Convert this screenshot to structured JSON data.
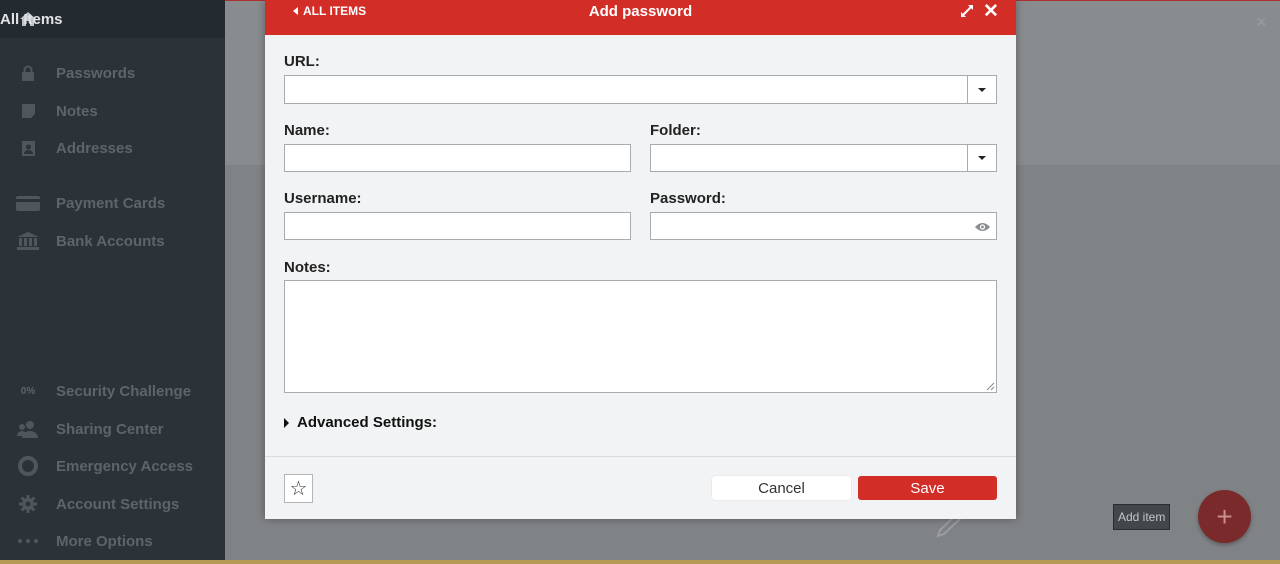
{
  "sidebar": {
    "top": {
      "label": "All Items",
      "icon": "home-icon"
    },
    "items": [
      {
        "label": "Passwords",
        "icon": "lock-icon"
      },
      {
        "label": "Notes",
        "icon": "note-icon"
      },
      {
        "label": "Addresses",
        "icon": "address-card-icon"
      },
      {
        "label": "Payment Cards",
        "icon": "credit-card-icon"
      },
      {
        "label": "Bank Accounts",
        "icon": "bank-icon"
      },
      {
        "label": "Security Challenge",
        "icon": "security-percent-icon",
        "badge": "0%"
      },
      {
        "label": "Sharing Center",
        "icon": "sharing-icon"
      },
      {
        "label": "Emergency Access",
        "icon": "lifebuoy-icon"
      },
      {
        "label": "Account Settings",
        "icon": "gear-icon"
      },
      {
        "label": "More Options",
        "icon": "dots-icon"
      }
    ]
  },
  "background": {
    "close_glyph": "×",
    "tooltip": "Add item",
    "fab_glyph": "+"
  },
  "modal": {
    "back_label": "ALL ITEMS",
    "title": "Add password",
    "close_glyph": "✕",
    "fields": {
      "url_label": "URL:",
      "url_value": "",
      "name_label": "Name:",
      "name_value": "",
      "folder_label": "Folder:",
      "folder_value": "",
      "username_label": "Username:",
      "username_value": "",
      "password_label": "Password:",
      "password_value": "",
      "notes_label": "Notes:",
      "notes_value": ""
    },
    "advanced_label": "Advanced Settings:",
    "favorite_glyph": "☆",
    "cancel_label": "Cancel",
    "save_label": "Save"
  },
  "colors": {
    "accent": "#d32d27",
    "sidebar_bg": "#2b3338",
    "overlay_bg": "#808386"
  }
}
